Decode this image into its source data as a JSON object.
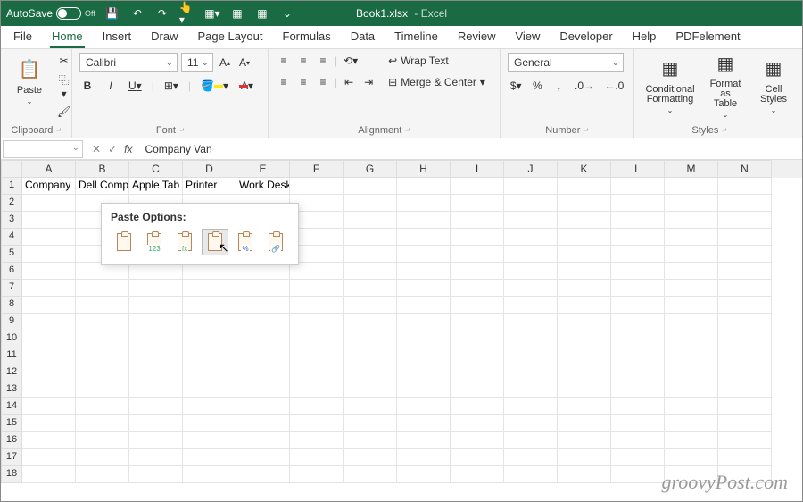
{
  "titlebar": {
    "autosave_label": "AutoSave",
    "autosave_state": "Off",
    "filename": "Book1.xlsx",
    "appname": "Excel"
  },
  "tabs": [
    "File",
    "Home",
    "Insert",
    "Draw",
    "Page Layout",
    "Formulas",
    "Data",
    "Timeline",
    "Review",
    "View",
    "Developer",
    "Help",
    "PDFelement"
  ],
  "active_tab": "Home",
  "ribbon": {
    "clipboard": {
      "label": "Clipboard",
      "paste": "Paste"
    },
    "font": {
      "label": "Font",
      "name": "Calibri",
      "size": "11",
      "bold": "B",
      "italic": "I",
      "underline": "U"
    },
    "alignment": {
      "label": "Alignment",
      "wrap": "Wrap Text",
      "merge": "Merge & Center"
    },
    "number": {
      "label": "Number",
      "format": "General",
      "currency": "$",
      "percent": "%",
      "comma": ","
    },
    "styles": {
      "label": "Styles",
      "cond": "Conditional Formatting",
      "fmt_table": "Format as Table",
      "cell_styles": "Cell Styles"
    }
  },
  "formula_bar": {
    "name_box": "",
    "value": "Company Van"
  },
  "columns": [
    "A",
    "B",
    "C",
    "D",
    "E",
    "F",
    "G",
    "H",
    "I",
    "J",
    "K",
    "L",
    "M",
    "N"
  ],
  "row_count": 18,
  "cells": {
    "r1": {
      "A": "Company",
      "B": "Dell Comp",
      "C": "Apple Tab",
      "D": "Printer",
      "E": "Work Desk"
    }
  },
  "popup": {
    "label": "Paste Options:",
    "options": [
      {
        "name": "paste",
        "sub": ""
      },
      {
        "name": "values",
        "sub": "123"
      },
      {
        "name": "formulas",
        "sub": "fx"
      },
      {
        "name": "transpose",
        "sub": ""
      },
      {
        "name": "formatting",
        "sub": ""
      },
      {
        "name": "link",
        "sub": ""
      }
    ],
    "hover_index": 3
  },
  "watermark": "groovyPost.com"
}
